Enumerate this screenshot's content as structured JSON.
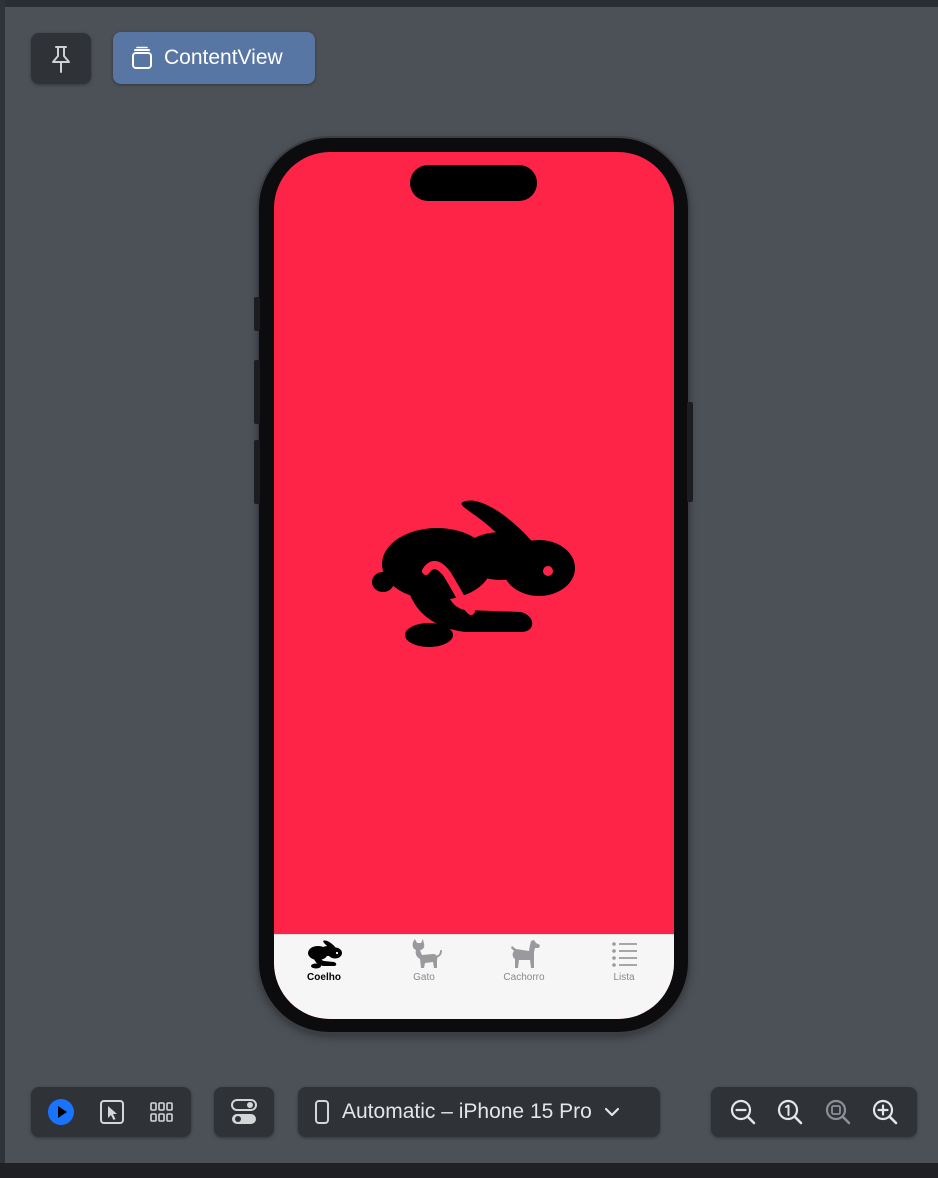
{
  "canvas": {
    "pin_icon": "pin-icon",
    "content_view_label": "ContentView"
  },
  "app": {
    "background_color": "#fe2447",
    "main_icon": "hare-fill-icon",
    "tabs": [
      {
        "label": "Coelho",
        "icon": "hare-fill-icon",
        "active": true
      },
      {
        "label": "Gato",
        "icon": "cat-fill-icon",
        "active": false
      },
      {
        "label": "Cachorro",
        "icon": "dog-fill-icon",
        "active": false
      },
      {
        "label": "Lista",
        "icon": "list-bullet-icon",
        "active": false
      }
    ]
  },
  "toolbar": {
    "device_label": "Automatic – iPhone 15 Pro",
    "accent_color": "#1a73ff"
  }
}
